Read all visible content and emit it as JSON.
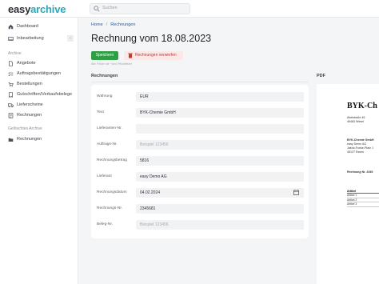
{
  "app": {
    "logo_main": "easy",
    "logo_accent": "archive",
    "search_placeholder": "Suchen"
  },
  "sidebar": {
    "items": [
      {
        "label": "Dashboard",
        "icon": "home-icon"
      },
      {
        "label": "Inbearbeitung",
        "icon": "inbox-icon"
      }
    ],
    "collapse_glyph": "‹",
    "section_archive": "Archive",
    "archive_items": [
      {
        "label": "Angebote",
        "icon": "document-icon"
      },
      {
        "label": "Auftragsbestätigungen",
        "icon": "checklist-icon"
      },
      {
        "label": "Bestellungen",
        "icon": "cart-icon"
      },
      {
        "label": "Gutschriften/Verkaufsbelege",
        "icon": "receipt-icon"
      },
      {
        "label": "Lieferscheine",
        "icon": "truck-icon"
      },
      {
        "label": "Rechnungen",
        "icon": "invoice-icon"
      }
    ],
    "section_deleted": "Gelöschtes Archive",
    "deleted_items": [
      {
        "label": "Rechnungen",
        "icon": "folder-icon"
      }
    ]
  },
  "main": {
    "breadcrumb": [
      "Home",
      "Rechnungen"
    ],
    "breadcrumb_sep": "/",
    "title": "Rechnung vom 18.08.2023",
    "save_label": "Speichern",
    "delete_label": "Rechnungen verwerfen",
    "hint": "Alle Felder mit * sind Pflichtfelder",
    "section_left": "Rechnungen",
    "section_right": "PDF",
    "fields": [
      {
        "label": "Währung",
        "value": "EUR",
        "placeholder": false
      },
      {
        "label": "Text",
        "value": "BYK-Chemie GmbH",
        "placeholder": false
      },
      {
        "label": "Lieferanten-Nr.",
        "value": "",
        "placeholder": false
      },
      {
        "label": "Auftrags-Nr.",
        "value": "Beispiel 123456",
        "placeholder": true
      },
      {
        "label": "Rechnungsbetrag",
        "value": "5816",
        "placeholder": false
      },
      {
        "label": "Lieferant",
        "value": "easy Demo AG",
        "placeholder": false
      },
      {
        "label": "Rechnungsdatum",
        "value": "04.02.2024",
        "placeholder": false
      },
      {
        "label": "Rechnungs-Nr.",
        "value": "2345681",
        "placeholder": false
      },
      {
        "label": "Beleg-Nr.",
        "value": "Beispiel 123456",
        "placeholder": true
      }
    ]
  },
  "pdf": {
    "title": "BYK-Ch",
    "sender": [
      "Abelstraße 45",
      "46483 Wesel"
    ],
    "recipient": [
      "BYK-Chemie GmbH",
      "easy Demo AG",
      "Jakob-Funke-Platz 1",
      "45127 Essen"
    ],
    "invoice_no_label": "Rechnung Nr. 2345",
    "table_header": "Artikel",
    "table_rows": [
      "Artikel 1",
      "Artikel 2",
      "Artikel 3"
    ]
  },
  "colors": {
    "accent": "#2aa8b8",
    "save_button": "#2f9e44",
    "delete_bg": "#fde8e8",
    "delete_text": "#c0392b",
    "link": "#2b5ea7"
  }
}
